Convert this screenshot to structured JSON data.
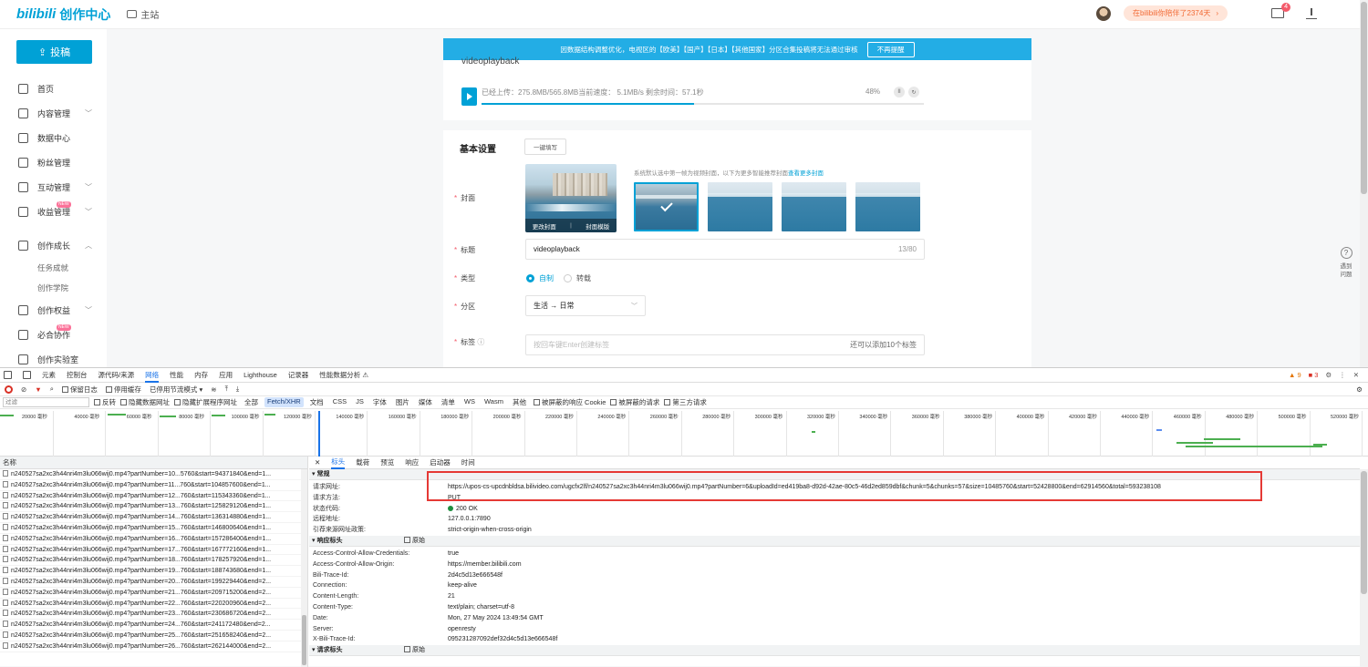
{
  "header": {
    "logo_brand": "bilibili",
    "logo_text": "创作中心",
    "home_label": "主站",
    "days_pill": "在bilibili你陪伴了2374天",
    "mail_badge": "4"
  },
  "sidebar": {
    "post_button": "投稿",
    "items": [
      {
        "label": "首页",
        "icon": "home-icon"
      },
      {
        "label": "内容管理",
        "icon": "content-icon",
        "chevron": "﹀"
      },
      {
        "label": "数据中心",
        "icon": "data-icon"
      },
      {
        "label": "粉丝管理",
        "icon": "fans-icon"
      },
      {
        "label": "互动管理",
        "icon": "interaction-icon",
        "chevron": "﹀"
      },
      {
        "label": "收益管理",
        "icon": "income-icon",
        "chevron": "﹀",
        "badge": "NEW"
      },
      {
        "label": "创作成长",
        "icon": "growth-icon",
        "chevron": "︿"
      },
      {
        "label": "任务成就"
      },
      {
        "label": "创作学院"
      },
      {
        "label": "创作权益",
        "icon": "rights-icon",
        "chevron": "﹀"
      },
      {
        "label": "必合协作",
        "icon": "collab-icon",
        "badge": "NEW"
      },
      {
        "label": "创作实验室",
        "icon": "lab-icon"
      }
    ]
  },
  "banner": {
    "text": "因数据结构调整优化，电视区的【欧美】【国产】【日本】【其他国家】分区合集投稿将无法通过审核",
    "button": "不再提醒"
  },
  "upload": {
    "video_title": "videoplayback",
    "progress_text": "已经上传：275.8MB/565.8MB当前速度： 5.1MB/s  剩余时间：57.1秒",
    "percent_label": "48%",
    "progress": 0.48,
    "pause_icon": "pause-icon",
    "refresh_icon": "refresh-icon"
  },
  "basic": {
    "title": "基本设置",
    "oneclick": "一键填写",
    "cover_label": "封面",
    "cover_change": "更改封面",
    "cover_template": "封面模版",
    "cover_hint": "系统默认选中第一帧为视频封面，以下为更多智能推荐封面",
    "cover_hint_link": "查看更多封面",
    "title_label": "标题",
    "title_value": "videoplayback",
    "title_counter": "13/80",
    "type_label": "类型",
    "type_self": "自制",
    "type_repost": "转载",
    "zone_label": "分区",
    "zone_value": "生活 → 日常",
    "tag_label": "标签",
    "tag_placeholder": "按回车键Enter创建标签",
    "tag_remaining": "还可以添加10个标签"
  },
  "help": {
    "label1": "遇到",
    "label2": "问题"
  },
  "devtools": {
    "tabs": [
      "元素",
      "控制台",
      "源代码/来源",
      "网络",
      "性能",
      "内存",
      "应用",
      "Lighthouse",
      "记录器",
      "性能数据分析 ⚠"
    ],
    "active_tab": "网络",
    "warnings": "9",
    "errors": "3",
    "toolbar": {
      "preserve_log": "保留日志",
      "disable_cache": "停用缓存",
      "throttle": "已停用节流模式"
    },
    "filter": {
      "placeholder": "过滤",
      "invert": "反转",
      "hide_data": "隐藏数据网址",
      "hide_ext": "隐藏扩展程序网址",
      "chips": [
        "全部",
        "Fetch/XHR",
        "文档",
        "CSS",
        "JS",
        "字体",
        "图片",
        "媒体",
        "清单",
        "WS",
        "Wasm",
        "其他"
      ],
      "selected_chip": "Fetch/XHR",
      "blocked_cookie": "被屏蔽的响应 Cookie",
      "blocked_req": "被屏蔽的请求",
      "third_party": "第三方请求"
    },
    "timeline_ticks": [
      "20000 毫秒",
      "40000 毫秒",
      "60000 毫秒",
      "80000 毫秒",
      "100000 毫秒",
      "120000 毫秒",
      "140000 毫秒",
      "160000 毫秒",
      "180000 毫秒",
      "200000 毫秒",
      "220000 毫秒",
      "240000 毫秒",
      "260000 毫秒",
      "280000 毫秒",
      "300000 毫秒",
      "320000 毫秒",
      "340000 毫秒",
      "360000 毫秒",
      "380000 毫秒",
      "400000 毫秒",
      "420000 毫秒",
      "440000 毫秒",
      "460000 毫秒",
      "480000 毫秒",
      "500000 毫秒",
      "520000 毫秒"
    ],
    "list_header": "名称",
    "requests": [
      "n240527sa2xc3h44nri4m3lu066wij0.mp4?partNumber=10...5760&start=94371840&end=1...",
      "n240527sa2xc3h44nri4m3lu066wij0.mp4?partNumber=11...760&start=104857600&end=1...",
      "n240527sa2xc3h44nri4m3lu066wij0.mp4?partNumber=12...760&start=115343360&end=1...",
      "n240527sa2xc3h44nri4m3lu066wij0.mp4?partNumber=13...760&start=125829120&end=1...",
      "n240527sa2xc3h44nri4m3lu066wij0.mp4?partNumber=14...760&start=136314880&end=1...",
      "n240527sa2xc3h44nri4m3lu066wij0.mp4?partNumber=15...760&start=146800640&end=1...",
      "n240527sa2xc3h44nri4m3lu066wij0.mp4?partNumber=16...760&start=157286400&end=1...",
      "n240527sa2xc3h44nri4m3lu066wij0.mp4?partNumber=17...760&start=167772160&end=1...",
      "n240527sa2xc3h44nri4m3lu066wij0.mp4?partNumber=18...760&start=178257920&end=1...",
      "n240527sa2xc3h44nri4m3lu066wij0.mp4?partNumber=19...760&start=188743680&end=1...",
      "n240527sa2xc3h44nri4m3lu066wij0.mp4?partNumber=20...760&start=199229440&end=2...",
      "n240527sa2xc3h44nri4m3lu066wij0.mp4?partNumber=21...760&start=209715200&end=2...",
      "n240527sa2xc3h44nri4m3lu066wij0.mp4?partNumber=22...760&start=220200960&end=2...",
      "n240527sa2xc3h44nri4m3lu066wij0.mp4?partNumber=23...760&start=230686720&end=2...",
      "n240527sa2xc3h44nri4m3lu066wij0.mp4?partNumber=24...760&start=241172480&end=2...",
      "n240527sa2xc3h44nri4m3lu066wij0.mp4?partNumber=25...760&start=251658240&end=2...",
      "n240527sa2xc3h44nri4m3lu066wij0.mp4?partNumber=26...760&start=262144000&end=2..."
    ],
    "detail_tabs": [
      "标头",
      "载荷",
      "预览",
      "响应",
      "启动器",
      "时间"
    ],
    "active_detail_tab": "标头",
    "general": {
      "heading": "▾ 常规",
      "rows": [
        {
          "k": "请求网址:",
          "v": "https://upos-cs-upcdnbldsa.bilivideo.com/ugcfx2lf/n240527sa2xc3h44nri4m3lu066wij0.mp4?partNumber=6&uploadId=ed419ba8-d92d-42ae-80c5-46d2ed859dbf&chunk=5&chunks=57&size=10485760&start=52428800&end=62914560&total=593238108"
        },
        {
          "k": "请求方法:",
          "v": "PUT"
        },
        {
          "k": "状态代码:",
          "v": "200 OK"
        },
        {
          "k": "远程地址:",
          "v": "127.0.0.1:7890"
        },
        {
          "k": "引荐来源网址政策:",
          "v": "strict-origin-when-cross-origin"
        }
      ]
    },
    "response": {
      "heading": "▾ 响应标头",
      "raw": "原始",
      "rows": [
        {
          "k": "Access-Control-Allow-Credentials:",
          "v": "true"
        },
        {
          "k": "Access-Control-Allow-Origin:",
          "v": "https://member.bilibili.com"
        },
        {
          "k": "Bili-Trace-Id:",
          "v": "2d4c5d13e666548f"
        },
        {
          "k": "Connection:",
          "v": "keep-alive"
        },
        {
          "k": "Content-Length:",
          "v": "21"
        },
        {
          "k": "Content-Type:",
          "v": "text/plain; charset=utf-8"
        },
        {
          "k": "Date:",
          "v": "Mon, 27 May 2024 13:49:54 GMT"
        },
        {
          "k": "Server:",
          "v": "openresty"
        },
        {
          "k": "X-Bili-Trace-Id:",
          "v": "095231287092def32d4c5d13e666548f"
        }
      ]
    },
    "request_heading": "▾ 请求标头",
    "request_raw": "原始"
  }
}
